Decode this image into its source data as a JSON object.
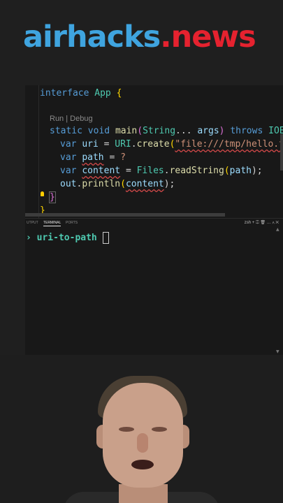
{
  "banner": {
    "part1": "airhacks",
    "dot": ".",
    "part2": "news"
  },
  "editor": {
    "codelens": "Run | Debug",
    "lines": {
      "l1": {
        "kw": "interface",
        "name": "App",
        "brace": "{"
      },
      "l3": {
        "kw1": "static",
        "kw2": "void",
        "fn": "main",
        "p1": "(",
        "type": "String",
        "dots": "...",
        "arg": "args",
        "p2": ")",
        "kw3": "throws",
        "exc": "IOEx"
      },
      "l4": {
        "kw": "var",
        "name": "uri",
        "eq": "=",
        "cls": "URI",
        "dot": ".",
        "fn": "create",
        "p": "(",
        "str": "\"file:///tmp/hello.tx"
      },
      "l5": {
        "kw": "var",
        "name": "path",
        "eq": "=",
        "q": "?"
      },
      "l6": {
        "kw": "var",
        "name": "content",
        "eq": "=",
        "cls": "Files",
        "dot": ".",
        "fn": "readString",
        "p1": "(",
        "arg": "path",
        "p2": ");"
      },
      "l7": {
        "obj": "out",
        "dot": ".",
        "fn": "println",
        "p1": "(",
        "arg": "content",
        "p2": ");"
      },
      "l8": {
        "brace": "}"
      },
      "l9": {
        "brace": "}"
      }
    }
  },
  "panel": {
    "tabs": [
      "UTPUT",
      "TERMINAL",
      "PORTS"
    ],
    "active_tab": "TERMINAL",
    "tools": "zsh  +  ⎅  🗑  …  ∧  ✕",
    "prompt": "› uri-to-path"
  }
}
